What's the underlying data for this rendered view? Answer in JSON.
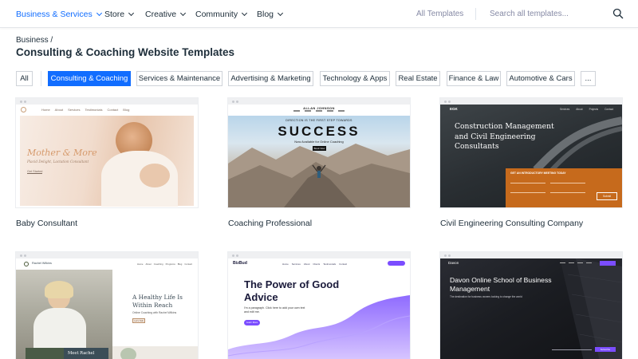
{
  "nav": {
    "items": [
      {
        "label": "Business & Services",
        "active": true
      },
      {
        "label": "Store",
        "active": false
      },
      {
        "label": "Creative",
        "active": false
      },
      {
        "label": "Community",
        "active": false
      },
      {
        "label": "Blog",
        "active": false
      }
    ],
    "all_templates": "All Templates",
    "search_placeholder": "Search all templates..."
  },
  "breadcrumb": "Business /",
  "page_title": "Consulting & Coaching Website Templates",
  "filters": [
    {
      "label": "All",
      "active": false
    },
    {
      "label": "Consulting & Coaching",
      "active": true
    },
    {
      "label": "Services & Maintenance",
      "active": false
    },
    {
      "label": "Advertising & Marketing",
      "active": false
    },
    {
      "label": "Technology & Apps",
      "active": false
    },
    {
      "label": "Real Estate",
      "active": false
    },
    {
      "label": "Finance & Law",
      "active": false
    },
    {
      "label": "Automotive & Cars",
      "active": false
    },
    {
      "label": "...",
      "active": false
    }
  ],
  "templates": [
    {
      "title": "Baby Consultant",
      "preview": {
        "nav_links": [
          "Home",
          "About",
          "Services",
          "Testimonials",
          "Contact",
          "Blog"
        ],
        "headline": "Mother & More",
        "subline": "Placid Delight, Lactation Consultant",
        "cta": "Get Started"
      }
    },
    {
      "title": "Coaching Professional",
      "preview": {
        "brand": "ALLAN JOHNSON",
        "kicker": "DIRECTION IS THE FIRST STEP TOWARDS",
        "headline": "SUCCESS",
        "subline": "Now Available for Online Coaching",
        "cta": "Book Now"
      }
    },
    {
      "title": "Civil Engineering Consulting Company",
      "preview": {
        "logo": "EGK",
        "nav_links": [
          "Services",
          "About",
          "Projects",
          "Contact"
        ],
        "headline": "Construction Management and Civil Engineering Consultants",
        "form_title": "GET AN INTRODUCTORY MEETING TODAY",
        "cta": "Submit"
      }
    },
    {
      "title": "",
      "preview": {
        "brand": "Rachel Wilkins",
        "nav_links": [
          "Home",
          "About",
          "Coaching",
          "Programs",
          "Blog",
          "Contact"
        ],
        "headline": "A Healthy Life Is Within Reach",
        "subline": "Online Coaching with Rachel Wilkins",
        "cta": "Let's Talk",
        "caption": "Meet Rachel"
      }
    },
    {
      "title": "",
      "preview": {
        "logo": "BizBud",
        "nav_links": [
          "Home",
          "Services",
          "About",
          "Clients",
          "Testimonials",
          "Contact"
        ],
        "headline": "The Power of Good Advice",
        "subline": "I'm a paragraph. Click here to add your own text and edit me.",
        "cta": "Learn More"
      }
    },
    {
      "title": "",
      "preview": {
        "logo": "Davon",
        "headline": "Davon Online School of Business Management",
        "subline": "The destination for business owners looking to change the world",
        "cta": "Subscribe"
      }
    }
  ],
  "colors": {
    "accent": "#116dff",
    "text": "#20303c",
    "muted": "#868aa5",
    "orange": "#c66a1c",
    "purple": "#7b4dff"
  }
}
